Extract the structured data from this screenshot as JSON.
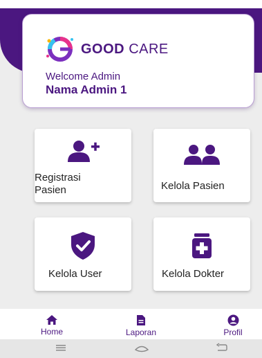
{
  "app": {
    "brand_bold": "GOOD",
    "brand_light": "CARE"
  },
  "header": {
    "welcome": "Welcome Admin",
    "admin_name": "Nama Admin 1"
  },
  "menu": [
    {
      "label": "Registrasi Pasien",
      "icon": "user-plus-icon"
    },
    {
      "label": "Kelola Pasien",
      "icon": "users-icon"
    },
    {
      "label": "Kelola User",
      "icon": "shield-check-icon"
    },
    {
      "label": "Kelola Dokter",
      "icon": "medical-kit-icon"
    }
  ],
  "bottom_nav": [
    {
      "label": "Home",
      "icon": "home-icon"
    },
    {
      "label": "Laporan",
      "icon": "document-icon"
    },
    {
      "label": "Profil",
      "icon": "user-circle-icon"
    }
  ],
  "colors": {
    "primary": "#4b1780",
    "background": "#ededed",
    "card": "#ffffff"
  }
}
